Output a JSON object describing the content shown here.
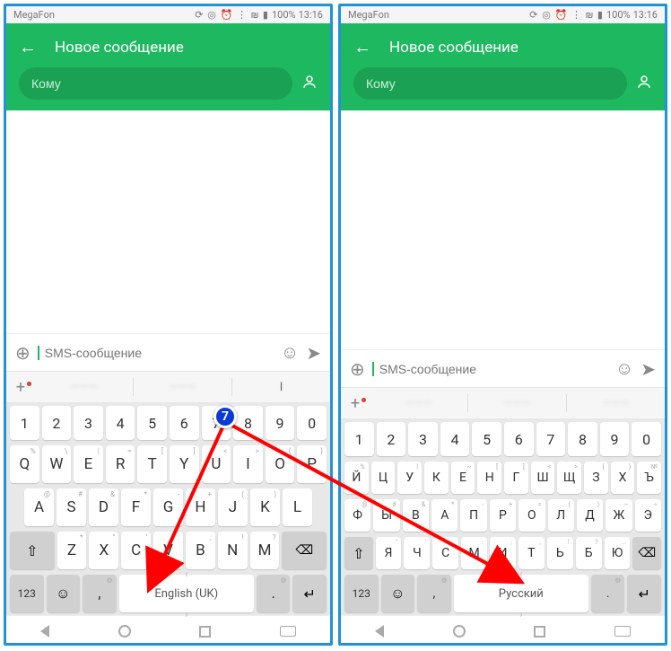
{
  "status": {
    "carrier": "MegaFon",
    "icons": "⟳ ◎ ⏰ ⋮ ₪ ▮",
    "battery": "100%",
    "time": "13:16"
  },
  "header": {
    "title": "Новое сообщение"
  },
  "recipient": {
    "placeholder": "Кому"
  },
  "compose": {
    "placeholder": "SMS-сообщение"
  },
  "badge": "7",
  "numbers": [
    "1",
    "2",
    "3",
    "4",
    "5",
    "6",
    "7",
    "8",
    "9",
    "0"
  ],
  "left": {
    "space_label": "English (UK)",
    "row1": [
      {
        "m": "Q",
        "s": "%"
      },
      {
        "m": "W",
        "s": "\\"
      },
      {
        "m": "E",
        "s": "|"
      },
      {
        "m": "R",
        "s": "="
      },
      {
        "m": "T",
        "s": "["
      },
      {
        "m": "Y",
        "s": "]"
      },
      {
        "m": "U",
        "s": "<"
      },
      {
        "m": "I",
        "s": ">"
      },
      {
        "m": "O",
        "s": "{"
      },
      {
        "m": "P",
        "s": "}"
      }
    ],
    "row2": [
      {
        "m": "A",
        "s": "@"
      },
      {
        "m": "S",
        "s": "#"
      },
      {
        "m": "D",
        "s": "&"
      },
      {
        "m": "F",
        "s": "*"
      },
      {
        "m": "G",
        "s": "-"
      },
      {
        "m": "H",
        "s": "+"
      },
      {
        "m": "J",
        "s": "("
      },
      {
        "m": "K",
        "s": ")"
      },
      {
        "m": "L",
        "s": ""
      }
    ],
    "row3": [
      {
        "m": "Z",
        "s": "*"
      },
      {
        "m": "X",
        "s": "\""
      },
      {
        "m": "C",
        "s": "'"
      },
      {
        "m": "V",
        "s": ":"
      },
      {
        "m": "B",
        "s": ";"
      },
      {
        "m": "N",
        "s": "!"
      },
      {
        "m": "M",
        "s": "?"
      }
    ]
  },
  "right": {
    "space_label": "Русский",
    "row1": [
      {
        "m": "Й",
        "s": "%"
      },
      {
        "m": "Ц",
        "s": ""
      },
      {
        "m": "У",
        "s": "|"
      },
      {
        "m": "К",
        "s": ""
      },
      {
        "m": "Е",
        "s": "~"
      },
      {
        "m": "Н",
        "s": "["
      },
      {
        "m": "Г",
        "s": "]"
      },
      {
        "m": "Ш",
        "s": "<"
      },
      {
        "m": "Щ",
        "s": ">"
      },
      {
        "m": "З",
        "s": "{"
      },
      {
        "m": "Х",
        "s": "}"
      },
      {
        "m": "Ъ",
        "s": "№"
      }
    ],
    "row2": [
      {
        "m": "Ф",
        "s": "@"
      },
      {
        "m": "Ы",
        "s": "#"
      },
      {
        "m": "В",
        "s": "&"
      },
      {
        "m": "А",
        "s": "*"
      },
      {
        "m": "П",
        "s": "-"
      },
      {
        "m": "Р",
        "s": "+"
      },
      {
        "m": "О",
        "s": "="
      },
      {
        "m": "Л",
        "s": "("
      },
      {
        "m": "Д",
        "s": ")"
      },
      {
        "m": "Ж",
        "s": "—"
      },
      {
        "m": "Э",
        "s": "÷"
      }
    ],
    "row3": [
      {
        "m": "Я",
        "s": "\""
      },
      {
        "m": "Ч",
        "s": "'"
      },
      {
        "m": "С",
        "s": ""
      },
      {
        "m": "М",
        "s": ":"
      },
      {
        "m": "И",
        "s": ";"
      },
      {
        "m": "Т",
        "s": ","
      },
      {
        "m": "Ь",
        "s": "!"
      },
      {
        "m": "Б",
        "s": "?"
      },
      {
        "m": "Ю",
        "s": "..."
      }
    ]
  },
  "bottom_keys": {
    "num": "123",
    "comma": ",",
    "period": "."
  }
}
